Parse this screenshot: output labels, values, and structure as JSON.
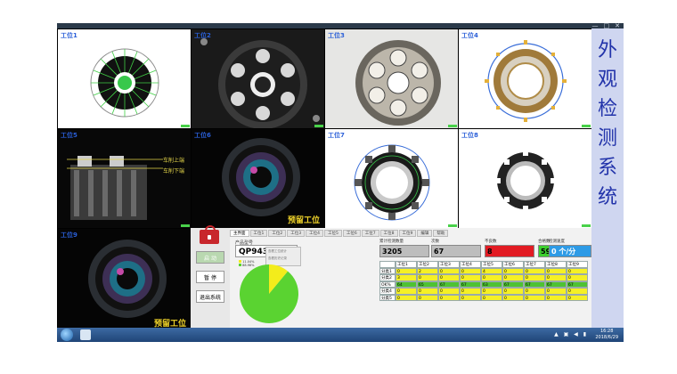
{
  "window": {
    "controls": [
      "—",
      "□",
      "✕"
    ]
  },
  "cells": [
    {
      "label": "工位1",
      "scene": "gear-white"
    },
    {
      "label": "工位2",
      "scene": "dark-plate"
    },
    {
      "label": "工位3",
      "scene": "gear-plate"
    },
    {
      "label": "工位4",
      "scene": "ring-white"
    },
    {
      "label": "工位5",
      "scene": "side-dark",
      "annotations": [
        "车削上端",
        "车削下端"
      ]
    },
    {
      "label": "工位6",
      "scene": "lens",
      "caption": "预留工位"
    },
    {
      "label": "工位7",
      "scene": "gear-big-white"
    },
    {
      "label": "工位8",
      "scene": "ring-small-white"
    },
    {
      "label": "工位9",
      "scene": "lens",
      "caption": "预留工位"
    }
  ],
  "side_title": [
    "外",
    "观",
    "检",
    "测",
    "系",
    "统"
  ],
  "controls": {
    "start": "启 动",
    "pause": "暂 停",
    "exit": "退出系统"
  },
  "tabs": [
    "主界面",
    "工位1",
    "工位2",
    "工位3",
    "工位4",
    "工位5",
    "工位6",
    "工位7",
    "工位8",
    "工位9",
    "编辑",
    "帮助"
  ],
  "product": {
    "label": "产品型号",
    "value": "QP943",
    "dropdown": [
      "查看工位统计",
      "查看历史记录"
    ]
  },
  "legend": [
    "11.04%",
    "88.96%"
  ],
  "stats": [
    {
      "label": "累计检测数量",
      "value": "3205",
      "color": "#bdbdbd"
    },
    {
      "label": "次数",
      "value": "67",
      "color": "#bdbdbd"
    },
    {
      "label": "不良数",
      "value": "8",
      "color": "#e21b23"
    },
    {
      "label": "合格数",
      "value": "59",
      "color": "#3ccf2e"
    },
    {
      "label": "检测速度",
      "value": "0 个/分",
      "color": "#2e9be6"
    }
  ],
  "table": {
    "header": [
      "",
      "工位1",
      "工位2",
      "工位3",
      "工位4",
      "工位5",
      "工位6",
      "工位7",
      "工位8",
      "工位9"
    ],
    "rows": [
      {
        "name": "分类1",
        "color": "#f5f025",
        "values": [
          "0",
          "2",
          "0",
          "0",
          "4",
          "0",
          "0",
          "0",
          "0"
        ]
      },
      {
        "name": "分类2",
        "color": "#f5f025",
        "values": [
          "3",
          "0",
          "0",
          "0",
          "0",
          "0",
          "0",
          "0",
          "0"
        ]
      },
      {
        "name": "OK%",
        "color": "#4ec233",
        "values": [
          "64",
          "65",
          "67",
          "67",
          "63",
          "67",
          "67",
          "67",
          "67"
        ]
      },
      {
        "name": "分类4",
        "color": "#f5f025",
        "values": [
          "0",
          "0",
          "0",
          "0",
          "0",
          "0",
          "0",
          "0",
          "0"
        ]
      },
      {
        "name": "分类5",
        "color": "#f5f025",
        "values": [
          "0",
          "0",
          "0",
          "0",
          "0",
          "0",
          "0",
          "0",
          "0"
        ]
      }
    ]
  },
  "pie": {
    "slices": [
      11.04,
      88.96
    ],
    "colors": [
      "#f3ec1b",
      "#5ad331"
    ]
  },
  "taskbar": {
    "time": "16:28",
    "date": "2018/6/29"
  }
}
